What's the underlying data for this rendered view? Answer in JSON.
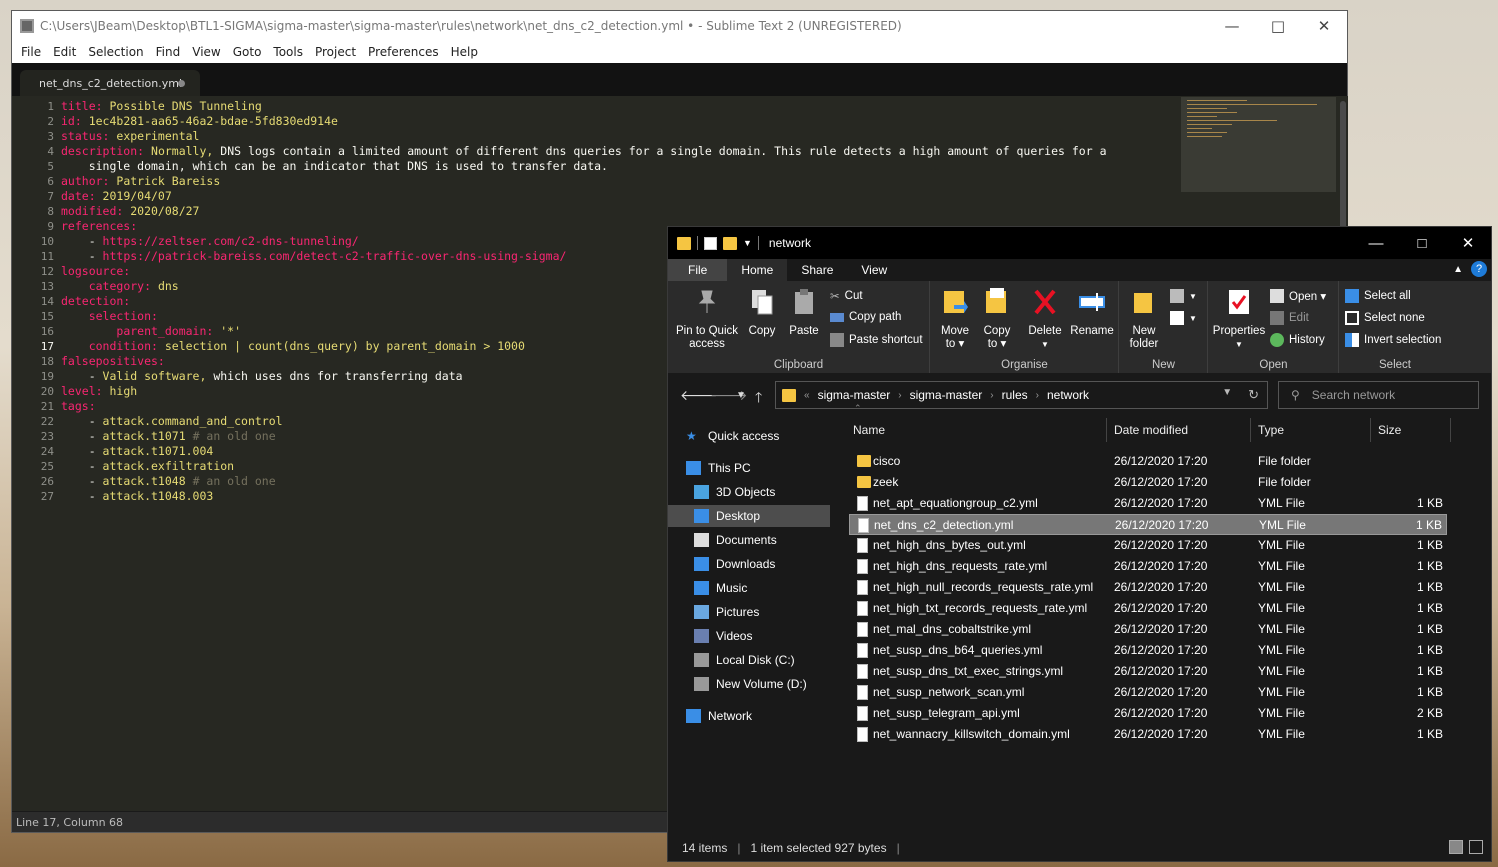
{
  "editor": {
    "title": "C:\\Users\\JBeam\\Desktop\\BTL1-SIGMA\\sigma-master\\sigma-master\\rules\\network\\net_dns_c2_detection.yml • - Sublime Text 2 (UNREGISTERED)",
    "menu": [
      "File",
      "Edit",
      "Selection",
      "Find",
      "View",
      "Goto",
      "Tools",
      "Project",
      "Preferences",
      "Help"
    ],
    "tab": "net_dns_c2_detection.yml",
    "status": "Line 17, Column 68",
    "current_line": 17,
    "lines": [
      [
        [
          "k",
          "title:"
        ],
        [
          "s",
          " Possible DNS Tunneling"
        ]
      ],
      [
        [
          "k",
          "id:"
        ],
        [
          "s",
          " 1ec4b281-aa65-46a2-bdae-5fd830ed914e"
        ]
      ],
      [
        [
          "k",
          "status:"
        ],
        [
          "s",
          " experimental"
        ]
      ],
      [
        [
          "k",
          "description:"
        ],
        [
          "s",
          " Normally,"
        ],
        [
          "p",
          " DNS logs contain a limited amount of different dns queries for a single domain. This rule detects a high amount of queries for a"
        ]
      ],
      [
        [
          "p",
          "    single domain, which can be an indicator that DNS is used to transfer data."
        ]
      ],
      [
        [
          "k",
          "author:"
        ],
        [
          "s",
          " Patrick Bareiss"
        ]
      ],
      [
        [
          "k",
          "date:"
        ],
        [
          "s",
          " 2019/04/07"
        ]
      ],
      [
        [
          "k",
          "modified:"
        ],
        [
          "s",
          " 2020/08/27"
        ]
      ],
      [
        [
          "k",
          "references:"
        ]
      ],
      [
        [
          "p",
          "    - "
        ],
        [
          "k",
          "https://zeltser.com/c2-dns-tunneling/"
        ]
      ],
      [
        [
          "p",
          "    - "
        ],
        [
          "k",
          "https://patrick-bareiss.com/detect-c2-traffic-over-dns-using-sigma/"
        ]
      ],
      [
        [
          "k",
          "logsource:"
        ]
      ],
      [
        [
          "p",
          "    "
        ],
        [
          "k",
          "category:"
        ],
        [
          "s",
          " dns"
        ]
      ],
      [
        [
          "k",
          "detection:"
        ]
      ],
      [
        [
          "p",
          "    "
        ],
        [
          "k",
          "selection:"
        ]
      ],
      [
        [
          "p",
          "        "
        ],
        [
          "k",
          "parent_domain:"
        ],
        [
          "s",
          " '*'"
        ]
      ],
      [
        [
          "p",
          "    "
        ],
        [
          "k",
          "condition:"
        ],
        [
          "s",
          " selection | count(dns_query) by parent_domain > 1000"
        ]
      ],
      [
        [
          "k",
          "falsepositives:"
        ]
      ],
      [
        [
          "p",
          "    - "
        ],
        [
          "s",
          "Valid software,"
        ],
        [
          "p",
          " which uses dns for transferring data"
        ]
      ],
      [
        [
          "k",
          "level:"
        ],
        [
          "s",
          " high"
        ]
      ],
      [
        [
          "k",
          "tags:"
        ]
      ],
      [
        [
          "p",
          "    - "
        ],
        [
          "s",
          "attack.command_and_control"
        ]
      ],
      [
        [
          "p",
          "    - "
        ],
        [
          "s",
          "attack.t1071"
        ],
        [
          "c",
          " # an old one"
        ]
      ],
      [
        [
          "p",
          "    - "
        ],
        [
          "s",
          "attack.t1071.004"
        ]
      ],
      [
        [
          "p",
          "    - "
        ],
        [
          "s",
          "attack.exfiltration"
        ]
      ],
      [
        [
          "p",
          "    - "
        ],
        [
          "s",
          "attack.t1048"
        ],
        [
          "c",
          " # an old one"
        ]
      ],
      [
        [
          "p",
          "    - "
        ],
        [
          "s",
          "attack.t1048.003"
        ]
      ]
    ]
  },
  "explorer": {
    "title": "network",
    "tabs": [
      "File",
      "Home",
      "Share",
      "View"
    ],
    "groups": {
      "clipboard": "Clipboard",
      "organise": "Organise",
      "new": "New",
      "open": "Open",
      "select": "Select"
    },
    "buttons": {
      "pin": "Pin to Quick access",
      "copy": "Copy",
      "paste": "Paste",
      "cut": "Cut",
      "copy_path": "Copy path",
      "paste_shortcut": "Paste shortcut",
      "move_to": "Move to ▾",
      "copy_to": "Copy to ▾",
      "delete": "Delete",
      "rename": "Rename",
      "new_folder": "New folder",
      "properties": "Properties",
      "open": "Open ▾",
      "edit": "Edit",
      "history": "History",
      "select_all": "Select all",
      "select_none": "Select none",
      "invert_selection": "Invert selection"
    },
    "address": [
      "sigma-master",
      "sigma-master",
      "rules",
      "network"
    ],
    "search_placeholder": "Search network",
    "nav": [
      "Quick access",
      "This PC",
      "3D Objects",
      "Desktop",
      "Documents",
      "Downloads",
      "Music",
      "Pictures",
      "Videos",
      "Local Disk (C:)",
      "New Volume (D:)",
      "Network"
    ],
    "columns": [
      "Name",
      "Date modified",
      "Type",
      "Size"
    ],
    "files": [
      {
        "name": "cisco",
        "date": "26/12/2020 17:20",
        "type": "File folder",
        "size": "",
        "folder": true
      },
      {
        "name": "zeek",
        "date": "26/12/2020 17:20",
        "type": "File folder",
        "size": "",
        "folder": true
      },
      {
        "name": "net_apt_equationgroup_c2.yml",
        "date": "26/12/2020 17:20",
        "type": "YML File",
        "size": "1 KB"
      },
      {
        "name": "net_dns_c2_detection.yml",
        "date": "26/12/2020 17:20",
        "type": "YML File",
        "size": "1 KB",
        "selected": true
      },
      {
        "name": "net_high_dns_bytes_out.yml",
        "date": "26/12/2020 17:20",
        "type": "YML File",
        "size": "1 KB"
      },
      {
        "name": "net_high_dns_requests_rate.yml",
        "date": "26/12/2020 17:20",
        "type": "YML File",
        "size": "1 KB"
      },
      {
        "name": "net_high_null_records_requests_rate.yml",
        "date": "26/12/2020 17:20",
        "type": "YML File",
        "size": "1 KB"
      },
      {
        "name": "net_high_txt_records_requests_rate.yml",
        "date": "26/12/2020 17:20",
        "type": "YML File",
        "size": "1 KB"
      },
      {
        "name": "net_mal_dns_cobaltstrike.yml",
        "date": "26/12/2020 17:20",
        "type": "YML File",
        "size": "1 KB"
      },
      {
        "name": "net_susp_dns_b64_queries.yml",
        "date": "26/12/2020 17:20",
        "type": "YML File",
        "size": "1 KB"
      },
      {
        "name": "net_susp_dns_txt_exec_strings.yml",
        "date": "26/12/2020 17:20",
        "type": "YML File",
        "size": "1 KB"
      },
      {
        "name": "net_susp_network_scan.yml",
        "date": "26/12/2020 17:20",
        "type": "YML File",
        "size": "1 KB"
      },
      {
        "name": "net_susp_telegram_api.yml",
        "date": "26/12/2020 17:20",
        "type": "YML File",
        "size": "2 KB"
      },
      {
        "name": "net_wannacry_killswitch_domain.yml",
        "date": "26/12/2020 17:20",
        "type": "YML File",
        "size": "1 KB"
      }
    ],
    "status": {
      "count": "14 items",
      "selection": "1 item selected  927 bytes"
    }
  }
}
